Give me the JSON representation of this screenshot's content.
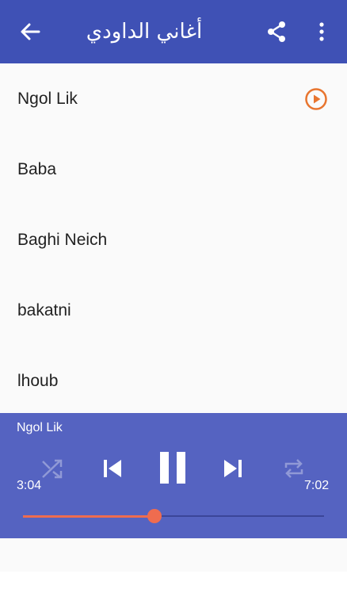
{
  "header": {
    "title": "أغاني الداودي",
    "back_icon": "arrow-left-icon",
    "share_icon": "share-icon",
    "more_icon": "more-vertical-icon",
    "color": "#3f51b5"
  },
  "songs": [
    {
      "name": "Ngol Lik",
      "playing": true
    },
    {
      "name": "Baba",
      "playing": false
    },
    {
      "name": "Baghi Neich",
      "playing": false
    },
    {
      "name": "bakatni",
      "playing": false
    },
    {
      "name": "lhoub",
      "playing": false
    }
  ],
  "player": {
    "now_playing": "Ngol Lik",
    "elapsed": "3:04",
    "total": "7:02",
    "progress": 0.437,
    "color": "#5563c1",
    "accent": "#ef6c4f",
    "controls": [
      "shuffle-icon",
      "skip-previous-icon",
      "pause-icon",
      "skip-next-icon",
      "repeat-icon"
    ]
  }
}
